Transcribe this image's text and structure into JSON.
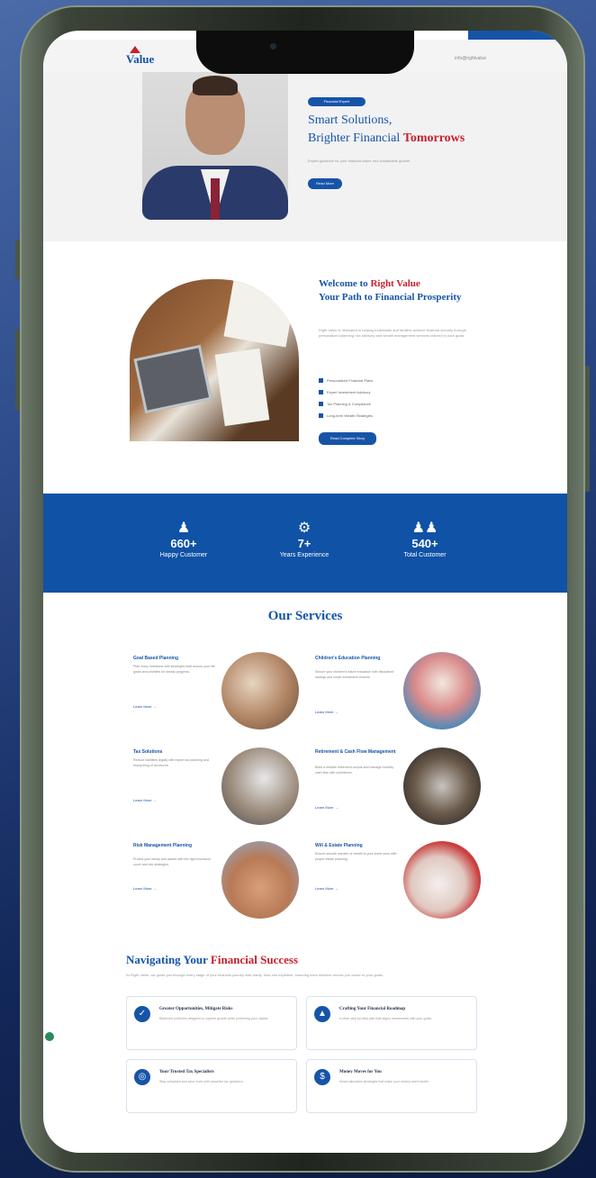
{
  "header": {
    "logo": "Value",
    "right_text": "info@rightvalue"
  },
  "hero": {
    "badge": "Financial Expert",
    "title_line1": "Smart Solutions,",
    "title_line2a": "Brighter Financial ",
    "title_line2b": "Tomorrows",
    "subtitle": "Expert guidance for your financial future and sustainable growth",
    "button": "Read More"
  },
  "welcome": {
    "title_a": "Welcome to ",
    "title_b": "Right Value",
    "title_c": "Your Path to Financial Prosperity",
    "paragraph": "Right Value is dedicated to helping individuals and families achieve financial security through personalized planning, tax advisory and wealth management services tailored to your goals.",
    "bullets": [
      "Personalized Financial Plans",
      "Expert Investment Advisory",
      "Tax Planning & Compliance",
      "Long-term Wealth Strategies"
    ],
    "button": "Read Complete Story"
  },
  "stats": [
    {
      "icon": "user-icon",
      "value": "660+",
      "label": "Happy Customer"
    },
    {
      "icon": "expert-icon",
      "value": "7+",
      "label": "Years Experience"
    },
    {
      "icon": "group-icon",
      "value": "540+",
      "label": "Total Customer"
    }
  ],
  "services": {
    "title": "Our Services",
    "items": [
      {
        "name": "Goal Based Planning",
        "text": "Plan every milestone with strategies built around your life goals and priorities for steady progress.",
        "link": "Learn More →"
      },
      {
        "name": "Children's Education Planning",
        "text": "Secure your children's future education with disciplined savings and smart investment choices.",
        "link": "Learn More →"
      },
      {
        "name": "Tax Solutions",
        "text": "Reduce liabilities legally with expert tax planning and timely filing of all returns.",
        "link": "Learn More →"
      },
      {
        "name": "Retirement & Cash Flow Management",
        "text": "Build a reliable retirement corpus and manage monthly cash flow with confidence.",
        "link": "Learn More →"
      },
      {
        "name": "Risk Management Planning",
        "text": "Protect your family and assets with the right insurance cover and risk strategies.",
        "link": "Learn More →"
      },
      {
        "name": "Will & Estate Planning",
        "text": "Ensure smooth transfer of wealth to your loved ones with proper estate planning.",
        "link": "Learn More →"
      }
    ]
  },
  "navigating": {
    "title_a": "Navigating Your ",
    "title_b": "Financial Success",
    "subtitle": "At Right Value, we guide you through every stage of your financial journey with clarity, trust and expertise, ensuring each decision moves you closer to your goals.",
    "cards": [
      {
        "icon": "opportunity-icon",
        "title": "Greater Opportunities, Mitigate Risks",
        "text": "Balanced portfolios designed to capture growth while protecting your capital."
      },
      {
        "icon": "chart-icon",
        "title": "Crafting Your Financial Roadmap",
        "text": "A clear step-by-step plan that aligns investments with your goals."
      },
      {
        "icon": "globe-icon",
        "title": "Your Trusted Tax Specialists",
        "text": "Stay compliant and save more with proactive tax guidance."
      },
      {
        "icon": "dollar-icon",
        "title": "Money Moves for You",
        "text": "Smart allocation strategies that make your money work harder."
      }
    ]
  }
}
